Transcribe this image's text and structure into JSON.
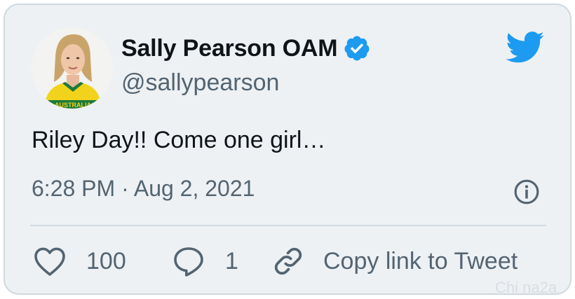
{
  "tweet": {
    "display_name": "Sally Pearson OAM",
    "handle": "@sallypearson",
    "text": "Riley Day!! Come one girl…",
    "timestamp": "6:28 PM · Aug 2, 2021",
    "likes": "100",
    "replies": "1",
    "copy_link_label": "Copy link to Tweet",
    "avatar_jersey_text": "AUSTRALIA"
  },
  "watermark": "Chi na2a",
  "colors": {
    "brand_blue": "#1d9bf0",
    "text_primary": "#0f1419",
    "text_secondary": "#536471",
    "card_background": "#eef1f4",
    "border": "#cfd9de"
  },
  "icons": {
    "brand": "twitter-bird-icon",
    "verified": "verified-badge-icon",
    "info": "info-icon",
    "like": "heart-icon",
    "reply": "speech-bubble-icon",
    "copy_link": "link-icon"
  }
}
